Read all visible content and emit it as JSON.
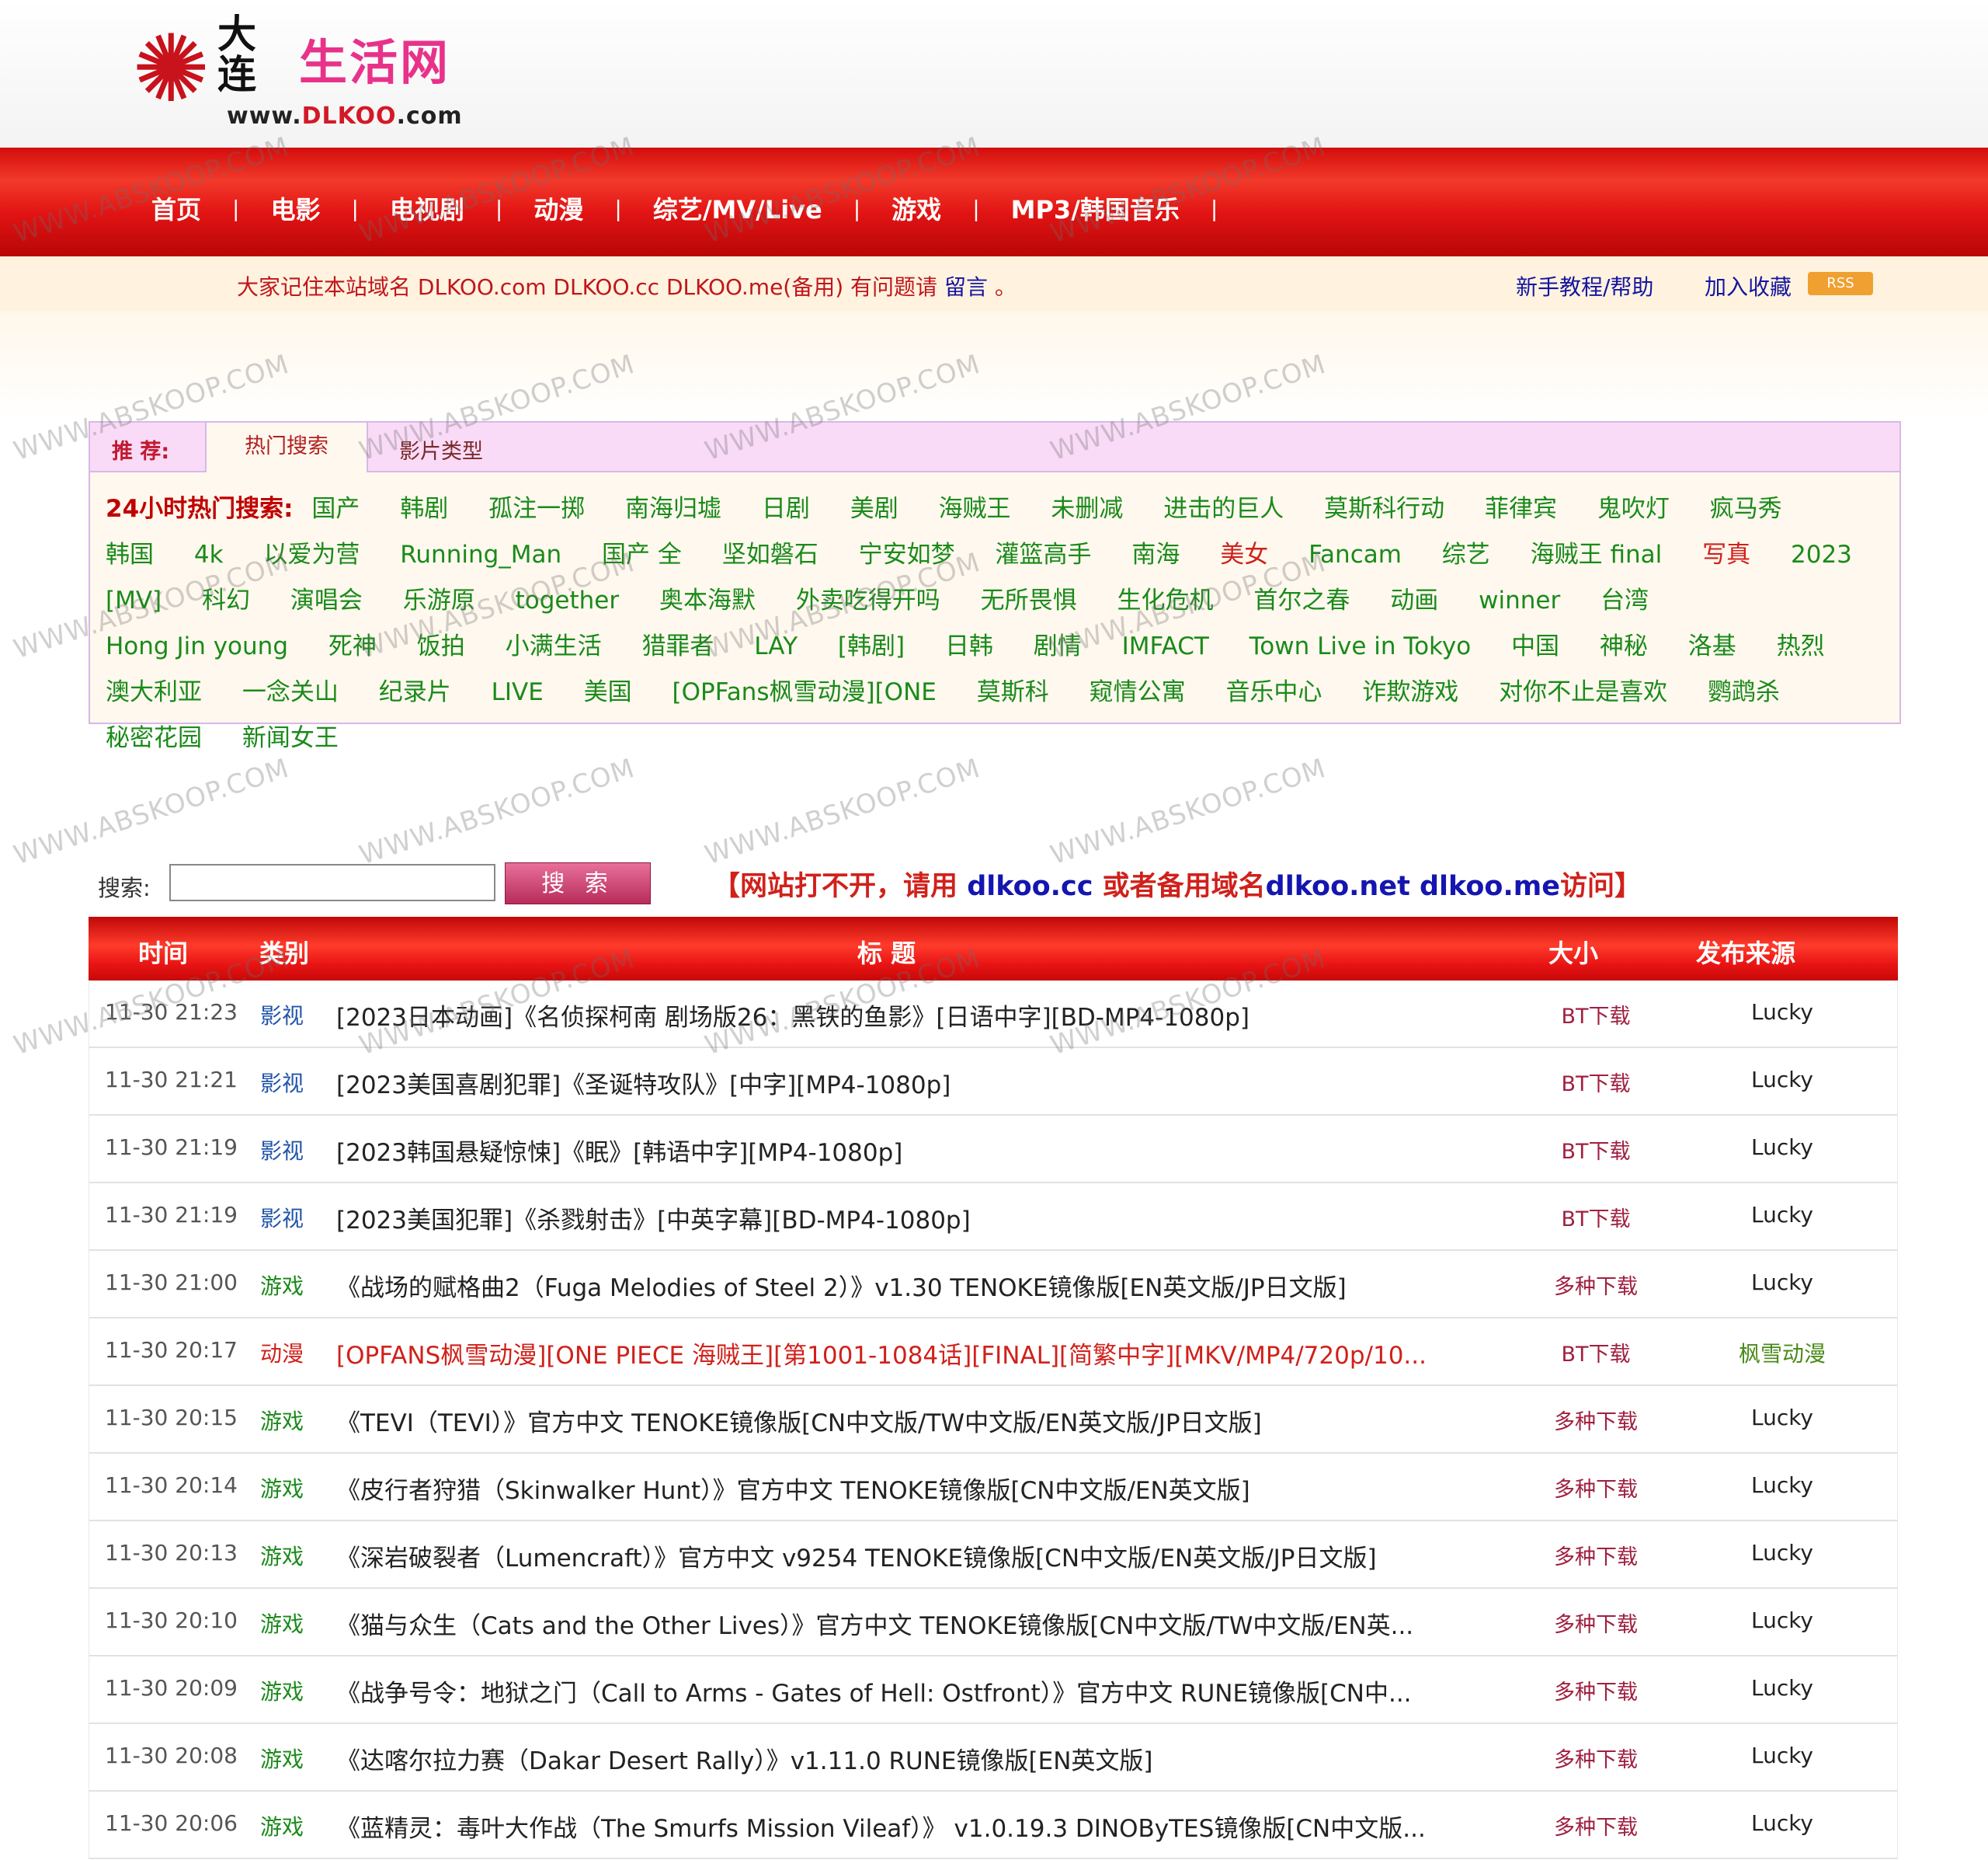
{
  "logo": {
    "dalian": "大连",
    "life": "生活网",
    "url_prefix": "www.",
    "url_brand": "DLKOO",
    "url_suffix": ".com"
  },
  "nav": {
    "items": [
      "首页",
      "电影",
      "电视剧",
      "动漫",
      "综艺/MV/Live",
      "游戏",
      "MP3/韩国音乐"
    ]
  },
  "infobar": {
    "notice_text": "大家记住本站域名 DLKOO.com DLKOO.cc DLKOO.me(备用) 有问题请",
    "notice_link": "留言",
    "notice_end": "。",
    "help": "新手教程/帮助",
    "favorite": "加入收藏",
    "rss": "RSS"
  },
  "recommend": {
    "label": "推 荐:",
    "tabs": [
      "热门搜索",
      "影片类型"
    ],
    "hot_label": "24小时热门搜索:",
    "hot_items": [
      {
        "t": "国产",
        "red": false
      },
      {
        "t": "韩剧",
        "red": false
      },
      {
        "t": "孤注一掷",
        "red": false
      },
      {
        "t": "南海归墟",
        "red": false
      },
      {
        "t": "日剧",
        "red": false
      },
      {
        "t": "美剧",
        "red": false
      },
      {
        "t": "海贼王",
        "red": false
      },
      {
        "t": "未删减",
        "red": false
      },
      {
        "t": "进击的巨人",
        "red": false
      },
      {
        "t": "莫斯科行动",
        "red": false
      },
      {
        "t": "菲律宾",
        "red": false
      },
      {
        "t": "鬼吹灯",
        "red": false
      },
      {
        "t": "疯马秀",
        "red": false
      },
      {
        "t": "韩国",
        "red": false
      },
      {
        "t": "4k",
        "red": false
      },
      {
        "t": "以爱为营",
        "red": false
      },
      {
        "t": "Running_Man",
        "red": false
      },
      {
        "t": "国产 全",
        "red": false
      },
      {
        "t": "坚如磐石",
        "red": false
      },
      {
        "t": "宁安如梦",
        "red": false
      },
      {
        "t": "灌篮高手",
        "red": false
      },
      {
        "t": "南海",
        "red": false
      },
      {
        "t": "美女",
        "red": true
      },
      {
        "t": "Fancam",
        "red": false
      },
      {
        "t": "综艺",
        "red": false
      },
      {
        "t": "海贼王 final",
        "red": false
      },
      {
        "t": "写真",
        "red": true
      },
      {
        "t": "2023",
        "red": false
      },
      {
        "t": "[MV]",
        "red": false
      },
      {
        "t": "科幻",
        "red": false
      },
      {
        "t": "演唱会",
        "red": false
      },
      {
        "t": "乐游原",
        "red": false
      },
      {
        "t": "together",
        "red": false
      },
      {
        "t": "奥本海默",
        "red": false
      },
      {
        "t": "外卖吃得开吗",
        "red": false
      },
      {
        "t": "无所畏惧",
        "red": false
      },
      {
        "t": "生化危机",
        "red": false
      },
      {
        "t": "首尔之春",
        "red": false
      },
      {
        "t": "动画",
        "red": false
      },
      {
        "t": "winner",
        "red": false
      },
      {
        "t": "台湾",
        "red": false
      },
      {
        "t": "Hong Jin young",
        "red": false
      },
      {
        "t": "死神",
        "red": false
      },
      {
        "t": "饭拍",
        "red": false
      },
      {
        "t": "小满生活",
        "red": false
      },
      {
        "t": "猎罪者",
        "red": false
      },
      {
        "t": "LAY",
        "red": false
      },
      {
        "t": "[韩剧]",
        "red": false
      },
      {
        "t": "日韩",
        "red": false
      },
      {
        "t": "剧情",
        "red": false
      },
      {
        "t": "IMFACT",
        "red": false
      },
      {
        "t": "Town Live in Tokyo",
        "red": false
      },
      {
        "t": "中国",
        "red": false
      },
      {
        "t": "神秘",
        "red": false
      },
      {
        "t": "洛基",
        "red": false
      },
      {
        "t": "热烈",
        "red": false
      },
      {
        "t": "澳大利亚",
        "red": false
      },
      {
        "t": "一念关山",
        "red": false
      },
      {
        "t": "纪录片",
        "red": false
      },
      {
        "t": "LIVE",
        "red": false
      },
      {
        "t": "美国",
        "red": false
      },
      {
        "t": "[OPFans枫雪动漫][ONE",
        "red": false
      },
      {
        "t": "莫斯科",
        "red": false
      },
      {
        "t": "窥情公寓",
        "red": false
      },
      {
        "t": "音乐中心",
        "red": false
      },
      {
        "t": "诈欺游戏",
        "red": false
      },
      {
        "t": "对你不止是喜欢",
        "red": false
      },
      {
        "t": "鹦鹉杀",
        "red": false
      },
      {
        "t": "秘密花园",
        "red": false
      },
      {
        "t": "新闻女王",
        "red": false
      }
    ]
  },
  "search": {
    "label": "搜索:",
    "value": "",
    "button": "搜 索",
    "alert_a": "【网站打不开，请用 ",
    "alert_b": "dlkoo.cc",
    "alert_c": " 或者备用域名",
    "alert_d": "dlkoo.net dlkoo.me",
    "alert_e": "访问】"
  },
  "table": {
    "headers": {
      "time": "时间",
      "category": "类别",
      "title": "标 题",
      "size": "大小",
      "source": "发布来源"
    },
    "rows": [
      {
        "time": "11-30 21:23",
        "cat": "影视",
        "kind": "film",
        "title": "[2023日本动画]《名侦探柯南 剧场版26：黑铁的鱼影》[日语中字][BD-MP4-1080p]",
        "hl": false,
        "size": "BT下载",
        "source": "Lucky",
        "src_green": false
      },
      {
        "time": "11-30 21:21",
        "cat": "影视",
        "kind": "film",
        "title": "[2023美国喜剧犯罪]《圣诞特攻队》[中字][MP4-1080p]",
        "hl": false,
        "size": "BT下载",
        "source": "Lucky",
        "src_green": false
      },
      {
        "time": "11-30 21:19",
        "cat": "影视",
        "kind": "film",
        "title": "[2023韩国悬疑惊悚]《眠》[韩语中字][MP4-1080p]",
        "hl": false,
        "size": "BT下载",
        "source": "Lucky",
        "src_green": false
      },
      {
        "time": "11-30 21:19",
        "cat": "影视",
        "kind": "film",
        "title": "[2023美国犯罪]《杀戮射击》[中英字幕][BD-MP4-1080p]",
        "hl": false,
        "size": "BT下载",
        "source": "Lucky",
        "src_green": false
      },
      {
        "time": "11-30 21:00",
        "cat": "游戏",
        "kind": "game",
        "title": "《战场的赋格曲2（Fuga Melodies of Steel 2）》v1.30 TENOKE镜像版[EN英文版/JP日文版]",
        "hl": false,
        "size": "多种下载",
        "source": "Lucky",
        "src_green": false
      },
      {
        "time": "11-30 20:17",
        "cat": "动漫",
        "kind": "anime",
        "title": "[OPFANS枫雪动漫][ONE PIECE 海贼王][第1001-1084话][FINAL][简繁中字][MKV/MP4/720p/10...",
        "hl": true,
        "size": "BT下载",
        "source": "枫雪动漫",
        "src_green": true
      },
      {
        "time": "11-30 20:15",
        "cat": "游戏",
        "kind": "game",
        "title": "《TEVI（TEVI）》官方中文 TENOKE镜像版[CN中文版/TW中文版/EN英文版/JP日文版]",
        "hl": false,
        "size": "多种下载",
        "source": "Lucky",
        "src_green": false
      },
      {
        "time": "11-30 20:14",
        "cat": "游戏",
        "kind": "game",
        "title": "《皮行者狩猎（Skinwalker Hunt）》官方中文 TENOKE镜像版[CN中文版/EN英文版]",
        "hl": false,
        "size": "多种下载",
        "source": "Lucky",
        "src_green": false
      },
      {
        "time": "11-30 20:13",
        "cat": "游戏",
        "kind": "game",
        "title": "《深岩破裂者（Lumencraft）》官方中文 v9254 TENOKE镜像版[CN中文版/EN英文版/JP日文版]",
        "hl": false,
        "size": "多种下载",
        "source": "Lucky",
        "src_green": false
      },
      {
        "time": "11-30 20:10",
        "cat": "游戏",
        "kind": "game",
        "title": "《猫与众生（Cats and the Other Lives）》官方中文 TENOKE镜像版[CN中文版/TW中文版/EN英...",
        "hl": false,
        "size": "多种下载",
        "source": "Lucky",
        "src_green": false
      },
      {
        "time": "11-30 20:09",
        "cat": "游戏",
        "kind": "game",
        "title": "《战争号令：地狱之门（Call to Arms - Gates of Hell: Ostfront）》官方中文 RUNE镜像版[CN中...",
        "hl": false,
        "size": "多种下载",
        "source": "Lucky",
        "src_green": false
      },
      {
        "time": "11-30 20:08",
        "cat": "游戏",
        "kind": "game",
        "title": "《达喀尔拉力赛（Dakar Desert Rally）》v1.11.0 RUNE镜像版[EN英文版]",
        "hl": false,
        "size": "多种下载",
        "source": "Lucky",
        "src_green": false
      },
      {
        "time": "11-30 20:06",
        "cat": "游戏",
        "kind": "game",
        "title": "《蓝精灵：毒叶大作战（The Smurfs Mission Vileaf）》 v1.0.19.3 DINOByTES镜像版[CN中文版...",
        "hl": false,
        "size": "多种下载",
        "source": "Lucky",
        "src_green": false
      }
    ]
  },
  "watermark": "WWW.ABSKOOP.COM"
}
